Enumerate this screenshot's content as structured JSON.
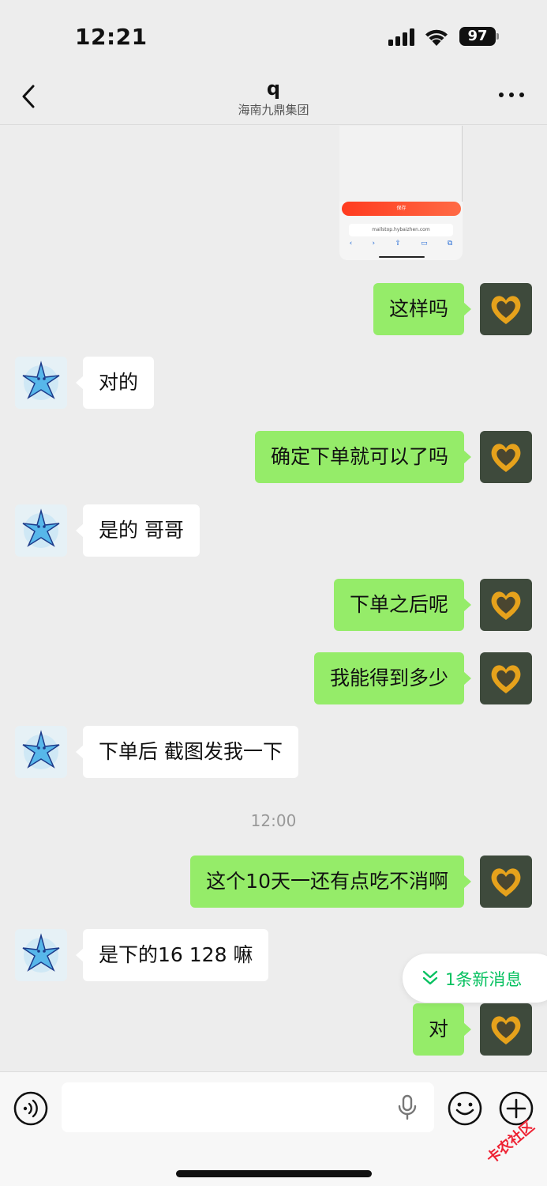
{
  "status": {
    "time": "12:21",
    "battery": "97"
  },
  "nav": {
    "title": "q",
    "subtitle": "海南九鼎集团"
  },
  "screenshot_preview": {
    "button_text": "保存",
    "url_text": "mallstop.hybaizhen.com"
  },
  "messages": [
    {
      "side": "me",
      "text": "这样吗"
    },
    {
      "side": "them",
      "text": "对的"
    },
    {
      "side": "me",
      "text": "确定下单就可以了吗"
    },
    {
      "side": "them",
      "text": "是的 哥哥"
    },
    {
      "side": "me",
      "text": "下单之后呢"
    },
    {
      "side": "me",
      "text": "我能得到多少"
    },
    {
      "side": "them",
      "text": "下单后 截图发我一下"
    },
    {
      "side": "me",
      "text": "这个10天一还有点吃不消啊"
    },
    {
      "side": "them",
      "text": "是下的16 128 嘛"
    },
    {
      "side": "me",
      "text": "对"
    }
  ],
  "timestamp": "12:00",
  "new_message_pill": "1条新消息",
  "input": {
    "placeholder": ""
  },
  "watermark": "卡农社区",
  "colors": {
    "self_bubble": "#95ec69",
    "other_bubble": "#ffffff",
    "accent": "#07c160",
    "background": "#ededed"
  }
}
